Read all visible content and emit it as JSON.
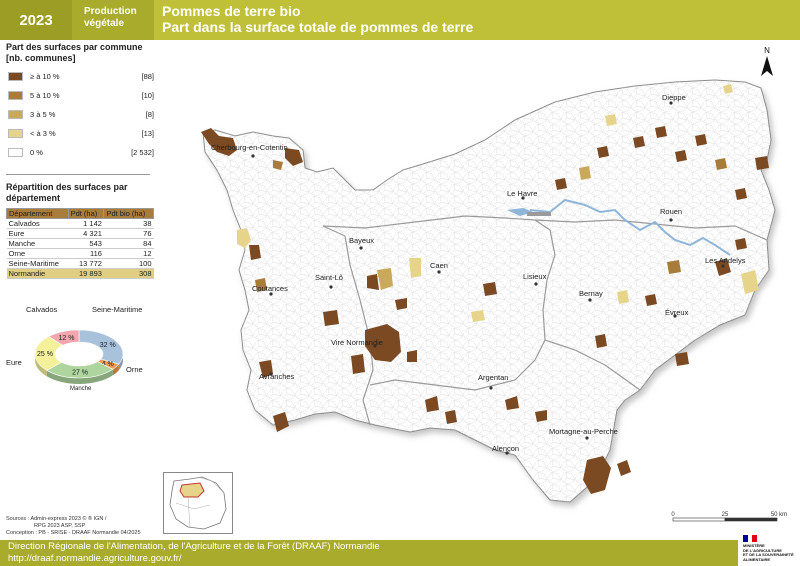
{
  "header": {
    "year": "2023",
    "category_line1": "Production",
    "category_line2": "végétale",
    "title_line1": "Pommes de terre bio",
    "title_line2": "Part dans la surface totale de pommes de terre"
  },
  "legend": {
    "title_line1": "Part des surfaces par commune",
    "title_line2": "[nb. communes]",
    "classes": [
      {
        "label": "≥ à 10 %",
        "count": "[88]",
        "color": "#7b4a23"
      },
      {
        "label": "5 à 10 %",
        "count": "[10]",
        "color": "#a87c3a"
      },
      {
        "label": "3 à 5 %",
        "count": "[8]",
        "color": "#c9a95a"
      },
      {
        "label": "< à 3 %",
        "count": "[13]",
        "color": "#e6d48a"
      },
      {
        "label": "0 %",
        "count": "[2 532]",
        "color": "#ffffff"
      }
    ]
  },
  "repartition": {
    "title_line1": "Répartition des surfaces par",
    "title_line2": "département",
    "headers": [
      "Département",
      "Pdt (ha)",
      "Pdt bio (ha)"
    ],
    "rows": [
      [
        "Calvados",
        "1 142",
        "38"
      ],
      [
        "Eure",
        "4 321",
        "76"
      ],
      [
        "Manche",
        "543",
        "84"
      ],
      [
        "Orne",
        "116",
        "12"
      ],
      [
        "Seine-Maritime",
        "13 772",
        "100"
      ]
    ],
    "total": [
      "Normandie",
      "19 893",
      "308"
    ]
  },
  "donut": {
    "slices": [
      {
        "name": "Seine-Maritime",
        "pct": 32,
        "label": "32 %",
        "color": "#a9c2dc"
      },
      {
        "name": "Orne",
        "pct": 4,
        "label": "4 %",
        "color": "#ee9a4c"
      },
      {
        "name": "Manche",
        "pct": 27,
        "label": "27 %",
        "color": "#aed59e"
      },
      {
        "name": "Eure",
        "pct": 25,
        "label": "25 %",
        "color": "#f4f19a"
      },
      {
        "name": "Calvados",
        "pct": 12,
        "label": "12 %",
        "color": "#f3a6ae"
      }
    ]
  },
  "map": {
    "places": [
      "Dieppe",
      "Cherbourg-en-Cotentin",
      "Le Havre",
      "Rouen",
      "Bayeux",
      "Caen",
      "Saint-Lô",
      "Lisieux",
      "Les Andelys",
      "Coutances",
      "Bernay",
      "Évreux",
      "Vire Normandie",
      "Avranches",
      "Argentan",
      "Mortagne-au-Perche",
      "Alençon"
    ],
    "north": "N",
    "scale": {
      "ticks": [
        "0",
        "25",
        "50 km"
      ]
    }
  },
  "sources": {
    "line1": "Sources : Admin-express 2023 © ® IGN /",
    "line2": "RPG 2023 ASP, SSP",
    "line3": "Conception : PB - SRISE - DRAAF Normandie 04/2025"
  },
  "footer": {
    "line1": "Direction Régionale de l'Alimentation, de l'Agriculture et de la Forêt (DRAAF) Normandie",
    "line2": "http://draaf.normandie.agriculture.gouv.fr/"
  },
  "logo": {
    "line1": "MINISTÈRE",
    "line2": "DE L'AGRICULTURE",
    "line3": "ET DE LA SOUVERAINETÉ",
    "line4": "ALIMENTAIRE"
  }
}
